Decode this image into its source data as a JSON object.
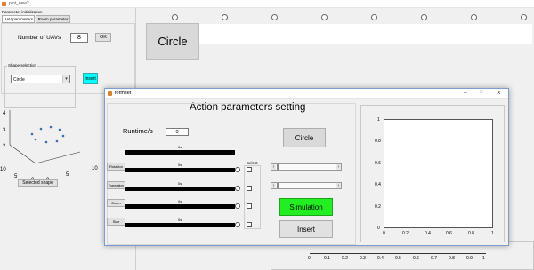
{
  "main_window": {
    "title": "plot_new2",
    "icon": "matlab-figure-icon"
  },
  "left_panel": {
    "group_title": "Parameter initialization",
    "tabs": [
      "UAV parameters",
      "Room parameter"
    ],
    "num_uavs_label": "Number of UAVs",
    "num_uavs_value": "8",
    "ok_label": "OK",
    "shape_group_title": "Shape selection",
    "shape_selected": "Circle",
    "insert_label": "Insert",
    "selected_shape_label": "Selected shape",
    "plot3d": {
      "z_ticks": [
        "4",
        "3",
        "2"
      ],
      "x_ticks": [
        "10",
        "5",
        "0"
      ],
      "y_ticks": [
        "0",
        "5",
        "10"
      ]
    }
  },
  "main_area": {
    "circle_label": "Circle",
    "bottom_axis_ticks": [
      "0",
      "0.1",
      "0.2",
      "0.3",
      "0.4",
      "0.5",
      "0.6",
      "0.7",
      "0.8",
      "0.9",
      "1"
    ]
  },
  "dialog": {
    "title": "formset",
    "heading": "Action parameters setting",
    "runtime_label": "Runtime/s",
    "runtime_value": "0",
    "circle_label": "Circle",
    "select_label": "Select",
    "bar_value_label": "0s",
    "rows": [
      {
        "label": ""
      },
      {
        "label": "Rotation"
      },
      {
        "label": "Translation"
      },
      {
        "label": "Zoom"
      },
      {
        "label": "Size"
      }
    ],
    "simulation_label": "Simulation",
    "insert_label": "Insert",
    "simulation_color": "#22ee22",
    "axes": {
      "y_ticks": [
        "1",
        "0.8",
        "0.6",
        "0.4",
        "0.2",
        "0"
      ],
      "x_ticks": [
        "0",
        "0.2",
        "0.4",
        "0.6",
        "0.8",
        "1"
      ]
    }
  },
  "colors": {
    "insert_cyan": "#00ffff",
    "simulation_green": "#22ee22"
  }
}
